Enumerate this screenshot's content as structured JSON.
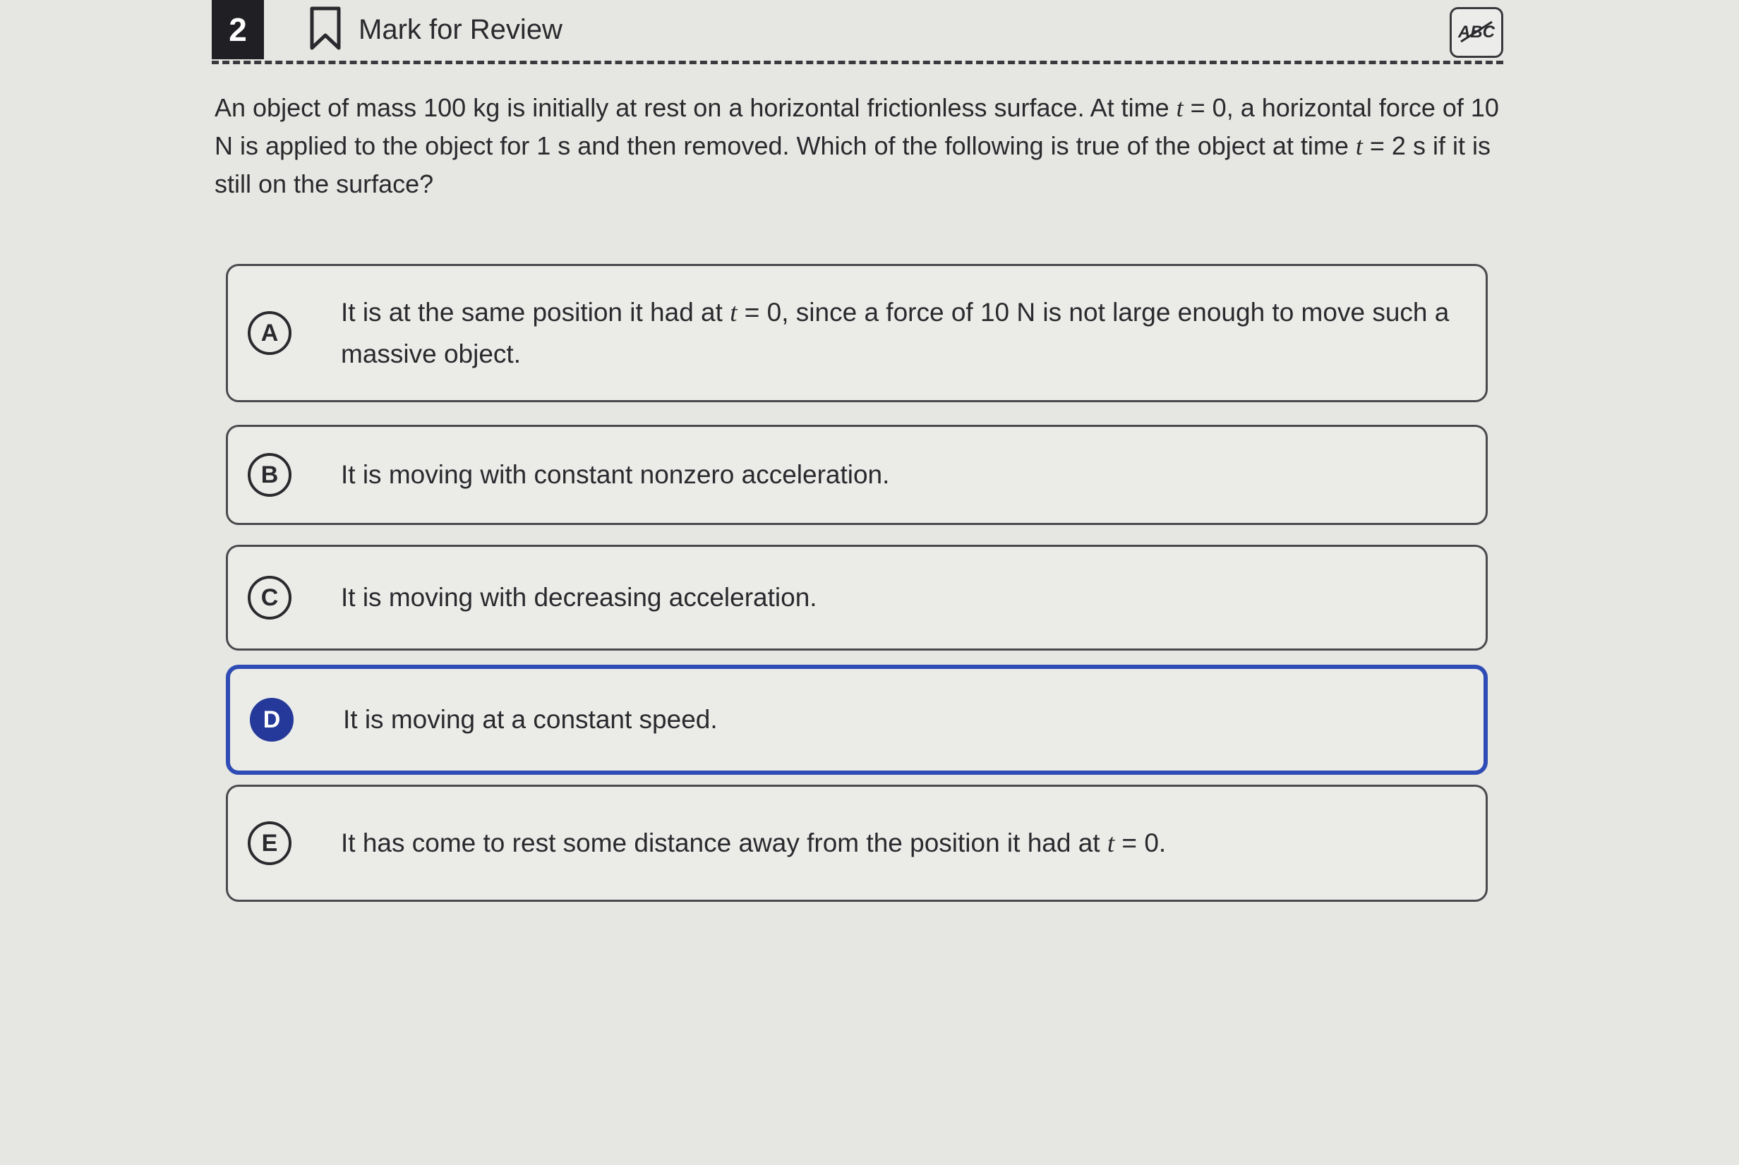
{
  "header": {
    "question_number": "2",
    "mark_label": "Mark for Review",
    "abc_tool_label": "ABC",
    "bookmark_icon": "bookmark-outline-icon",
    "abc_icon": "strikethrough-abc-icon"
  },
  "question": {
    "part1": "An object of mass 100 kg is initially at rest on a horizontal frictionless surface. At time ",
    "var1": "t",
    "part2": " = 0, a horizontal force of 10 N is applied to the object for 1 s and then removed. Which of the following is true of the object at time ",
    "var2": "t",
    "part3": " = 2 s if it is still on the surface?"
  },
  "choices": [
    {
      "letter": "A",
      "text1": "It is at the same position it had at ",
      "var": "t",
      "text2": " = 0, since a force of 10 N is not large enough to move such a massive object.",
      "selected": false
    },
    {
      "letter": "B",
      "text": "It is moving with constant nonzero acceleration.",
      "selected": false
    },
    {
      "letter": "C",
      "text": "It is moving with decreasing acceleration.",
      "selected": false
    },
    {
      "letter": "D",
      "text": "It is moving at a constant speed.",
      "selected": true
    },
    {
      "letter": "E",
      "text1": "It has come to rest some distance away from the position it had at ",
      "var": "t",
      "text2": " = 0.",
      "selected": false
    }
  ],
  "colors": {
    "selected_accent": "#2f4bb5",
    "question_number_bg": "#1f1f24"
  }
}
